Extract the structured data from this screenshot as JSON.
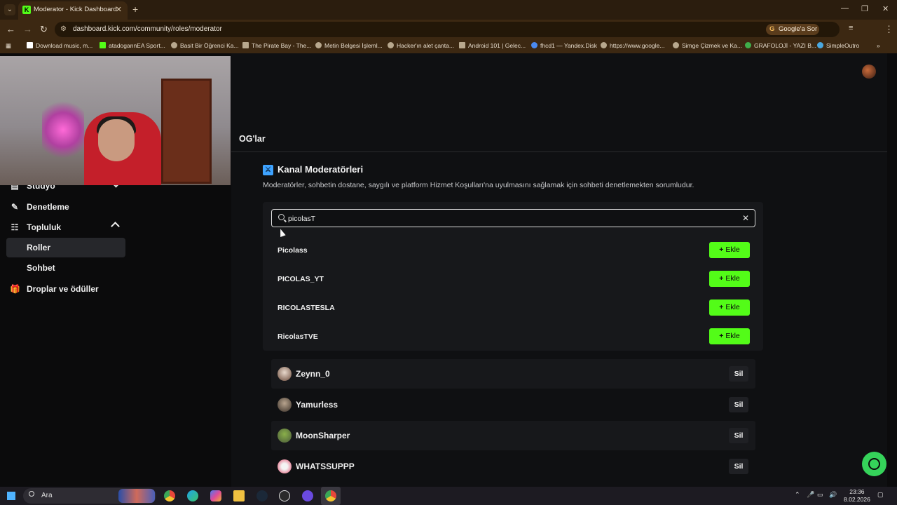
{
  "browser": {
    "tab_title": "Moderator - Kick Dashboard",
    "url": "dashboard.kick.com/community/roles/moderator",
    "google_ask": "Google'a Sor",
    "bookmarks": [
      "Download music, m...",
      "atadogannEA Sport...",
      "Basit Bir Öğrenci Ka...",
      "The Pirate Bay - The...",
      "Metin Belgesi İşleml...",
      "Hacker'ın alet çanta...",
      "Android 101 | Gelec...",
      "fhcd1 — Yandex.Disk",
      "https://www.google...",
      "Simge Çizmek ve Ka...",
      "GRAFOLOJİ - YAZI B...",
      "SimpleOutro"
    ]
  },
  "sidebar": {
    "studio": "Stüdyo",
    "denetleme": "Denetleme",
    "topluluk": "Topluluk",
    "roller": "Roller",
    "sohbet": "Sohbet",
    "droplar": "Droplar ve ödüller"
  },
  "main": {
    "og_title": "OG'lar",
    "section_title": "Kanal Moderatörleri",
    "section_desc": "Moderatörler, sohbetin dostane, saygılı ve platform Hizmet Koşulları'na uyulmasını sağlamak için sohbeti denetlemekten sorumludur.",
    "search_value": "picolasT",
    "add_label": "Ekle",
    "remove_label": "Sil",
    "suggestions": [
      "Picolass",
      "PICOLAS_YT",
      "RICOLASTESLA",
      "RicolasTVE"
    ],
    "moderators": [
      "Zeynn_0",
      "Yamurless",
      "MoonSharper",
      "WHATSSUPPP"
    ]
  },
  "taskbar": {
    "search_label": "Ara",
    "time": "23:36",
    "date": "8.02.2026"
  },
  "colors": {
    "accent_green": "#53fc18",
    "browser_frame": "#3c2812",
    "background": "#0b0b0c"
  }
}
